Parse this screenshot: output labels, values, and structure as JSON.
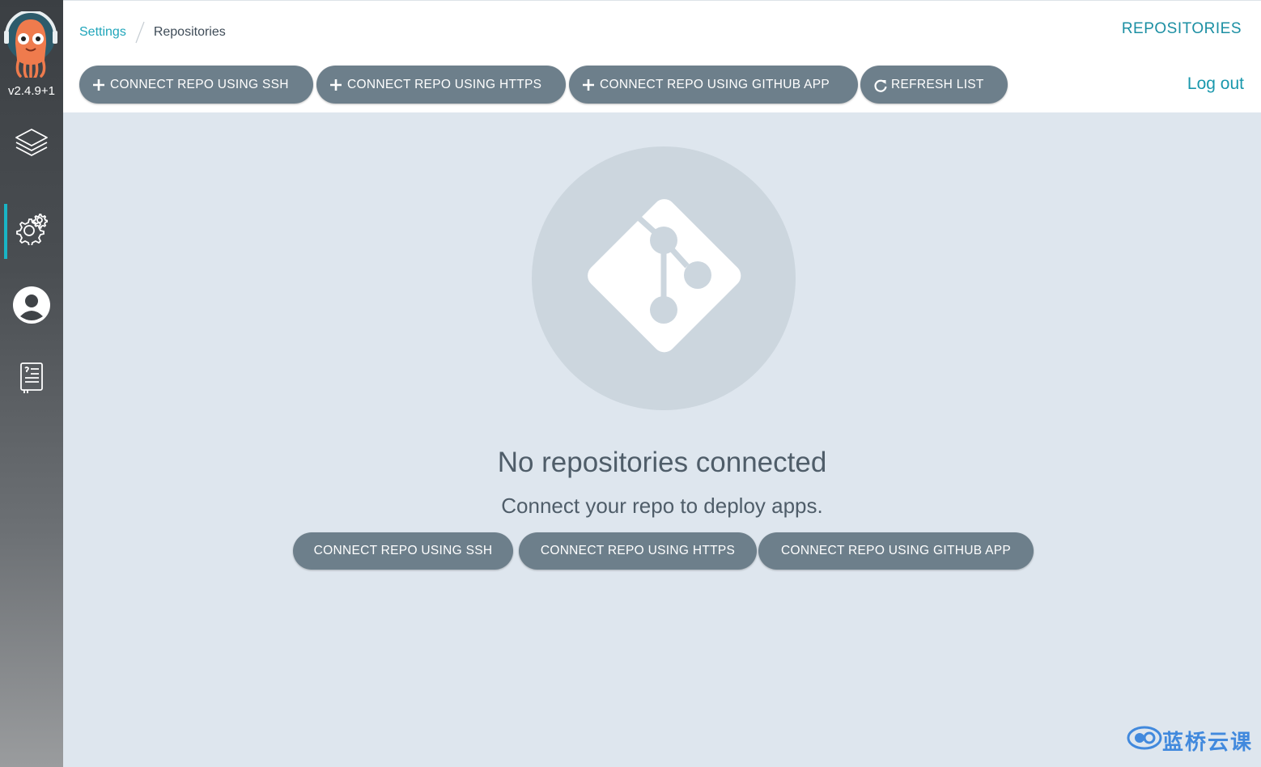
{
  "app": {
    "version": "v2.4.9+1"
  },
  "sidebar": {
    "items": [
      {
        "icon": "layers-icon"
      },
      {
        "icon": "gear-icon",
        "active": true
      },
      {
        "icon": "user-icon"
      },
      {
        "icon": "docs-icon"
      }
    ]
  },
  "breadcrumb": {
    "parent": "Settings",
    "current": "Repositories"
  },
  "header": {
    "title": "REPOSITORIES"
  },
  "toolbar": {
    "connect_ssh": "CONNECT REPO USING SSH",
    "connect_https": "CONNECT REPO USING HTTPS",
    "connect_github_app": "CONNECT REPO USING GITHUB APP",
    "refresh": "REFRESH LIST",
    "logout": "Log out"
  },
  "empty_state": {
    "icon": "git-icon",
    "title": "No repositories connected",
    "subtitle": "Connect your repo to deploy apps.",
    "buttons": {
      "ssh": "CONNECT REPO USING SSH",
      "https": "CONNECT REPO USING HTTPS",
      "github_app": "CONNECT REPO USING GITHUB APP"
    }
  },
  "watermark": {
    "text": "蓝桥云课"
  },
  "colors": {
    "accent": "#1fa5ba",
    "button": "#6d7f8b",
    "background": "#dee6ee"
  }
}
